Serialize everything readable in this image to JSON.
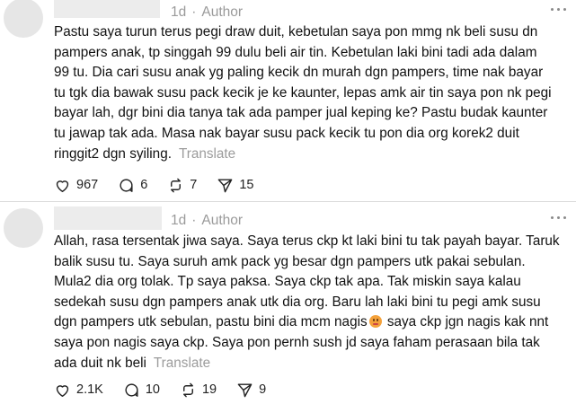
{
  "posts": [
    {
      "time": "1d",
      "role": "Author",
      "lines": [
        "Pastu saya turun terus pegi draw duit, kebetulan saya pon mmg nk beli susu dn",
        "pampers anak, tp singgah 99 dulu beli air tin. Kebetulan laki bini tadi ada dalam",
        "99 tu. Dia cari susu anak yg paling kecik dn murah dgn pampers, time nak bayar",
        "tu tgk dia bawak susu pack kecik je ke kaunter, lepas amk air tin saya pon nk pegi",
        "bayar lah, dgr bini dia tanya tak ada pamper jual keping ke? Pastu budak kaunter",
        "tu jawap tak ada. Masa nak bayar susu pack kecik tu pon dia org korek2 duit",
        "ringgit2 dgn syiling."
      ],
      "translate": "Translate",
      "likes": "967",
      "replies": "6",
      "reposts": "7",
      "shares": "15"
    },
    {
      "time": "1d",
      "role": "Author",
      "lines": [
        "Allah, rasa tersentak jiwa saya. Saya terus ckp kt laki bini tu tak payah bayar. Taruk",
        "balik susu tu. Saya suruh amk pack yg besar dgn pampers utk pakai sebulan.",
        "Mula2 dia org tolak. Tp saya paksa. Saya ckp tak apa. Tak miskin saya kalau",
        "sedekah susu dgn pampers anak utk dia org. Baru lah laki bini tu pegi amk susu",
        "dgn pampers utk sebulan, pastu bini dia mcm nagis",
        " saya ckp jgn nagis kak nnt",
        "saya pon nagis saya ckp. Saya pon pernh sush jd saya faham perasaan bila tak",
        "ada duit nk beli"
      ],
      "translate": "Translate",
      "likes": "2.1K",
      "replies": "10",
      "reposts": "19",
      "shares": "9"
    }
  ],
  "icons": {
    "like": "heart-icon",
    "reply": "comment-icon",
    "repost": "repost-icon",
    "share": "send-icon",
    "more": "more-icon",
    "emoji": "crying-face-emoji"
  }
}
